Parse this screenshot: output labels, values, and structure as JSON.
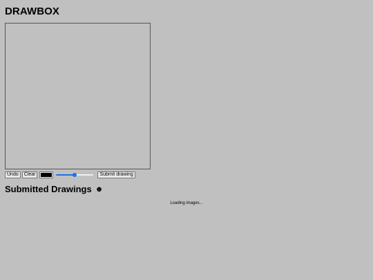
{
  "app": {
    "title": "DRAWBOX"
  },
  "toolbar": {
    "undo_label": "Undo",
    "clear_label": "Clear",
    "color_value": "#000000",
    "brush_size_fraction": 0.5,
    "submit_label": "Submit drawing",
    "accent_color": "#1a73e8"
  },
  "gallery": {
    "title": "Submitted Drawings",
    "icon": "smiley-icon",
    "icon_glyph": "☻",
    "status_text": "Loading images..."
  }
}
